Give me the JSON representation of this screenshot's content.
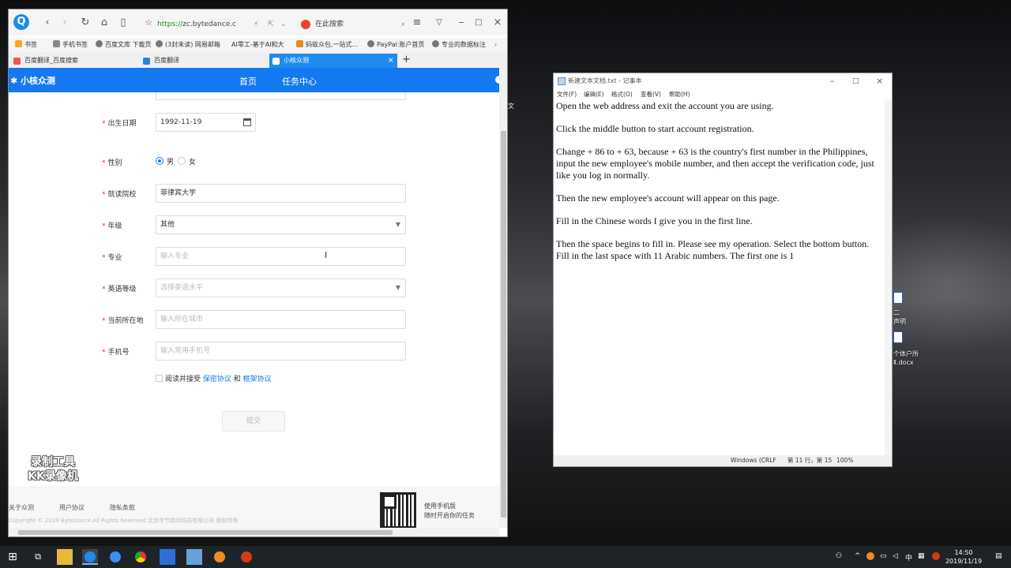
{
  "browser": {
    "url_scheme": "https://",
    "url_host": "zc.bytedance.c",
    "search_text": "在此搜索",
    "bookmarks": [
      "书签",
      "手机书签",
      "百度文库 下载页",
      "(3封未读) 网易邮箱",
      "AI零工-基于AI和大",
      "蚂蚁众包,一站式...",
      "PayPal:账户首页",
      "专业的数据标注"
    ],
    "tabs": [
      "百度翻译_百度搜索",
      "百度翻译",
      "小核众测"
    ],
    "new_tab": "+"
  },
  "site": {
    "logo": "小核众测",
    "nav": [
      "首页",
      "任务中心"
    ]
  },
  "form": {
    "birth_label": "出生日期",
    "birth_value": "1992-11-19",
    "gender_label": "性别",
    "gender_male": "男",
    "gender_female": "女",
    "school_label": "就读院校",
    "school_value": "菲律宾大学",
    "grade_label": "年级",
    "grade_value": "其他",
    "major_label": "专业",
    "major_placeholder": "输入专业",
    "english_label": "英语等级",
    "english_placeholder": "选择英语水平",
    "location_label": "当前所在地",
    "location_placeholder": "输入所在城市",
    "phone_label": "手机号",
    "phone_placeholder": "输入常用手机号",
    "agree_prefix": "阅读并接受",
    "privacy_link": "保密协议",
    "and_text": "和",
    "framework_link": "框架协议",
    "submit_label": "提交"
  },
  "footer": {
    "links": [
      "关于众测",
      "用户协议",
      "隐私条款"
    ],
    "copyright": "Copyright © 2019 ByteDance.All Rights Reserved 北京字节跳动科技有限公司 版权所有",
    "qr_line1": "使用手机版",
    "qr_line2": "随时开启你的任务"
  },
  "watermark": {
    "line1": "录制工具",
    "line2": "KK录像机"
  },
  "notepad": {
    "title": "新建文本文档.txt - 记事本",
    "menu": [
      "文件(F)",
      "编辑(E)",
      "格式(O)",
      "查看(V)",
      "帮助(H)"
    ],
    "paragraphs": [
      "Open the web address and exit the account you are using.",
      "Click the middle button to start account registration.",
      "Change + 86 to + 63, because + 63 is the country's first number in the Philippines, input the new employee's mobile number, and then accept the verification code, just like you log in normally.",
      "Then the new employee's account will appear on this page.",
      "Fill in the Chinese words I give you in the first line.",
      "Then the space begins to fill in. Please see my operation. Select the bottom button. Fill in the last space with 11 Arabic numbers. The first one is 1"
    ],
    "status_encoding": "Windows (CRLF",
    "status_position": "第 11 行，第 15",
    "status_zoom": "100%"
  },
  "desktop": {
    "labels": [
      "文",
      "二",
      "声明",
      "个体户所",
      "Ⅱ.docx"
    ]
  },
  "taskbar": {
    "time": "14:50",
    "date": "2019/11/19",
    "ime": "中"
  },
  "colors": {
    "brand_blue": "#1478f0",
    "required_star": "#e13333"
  }
}
